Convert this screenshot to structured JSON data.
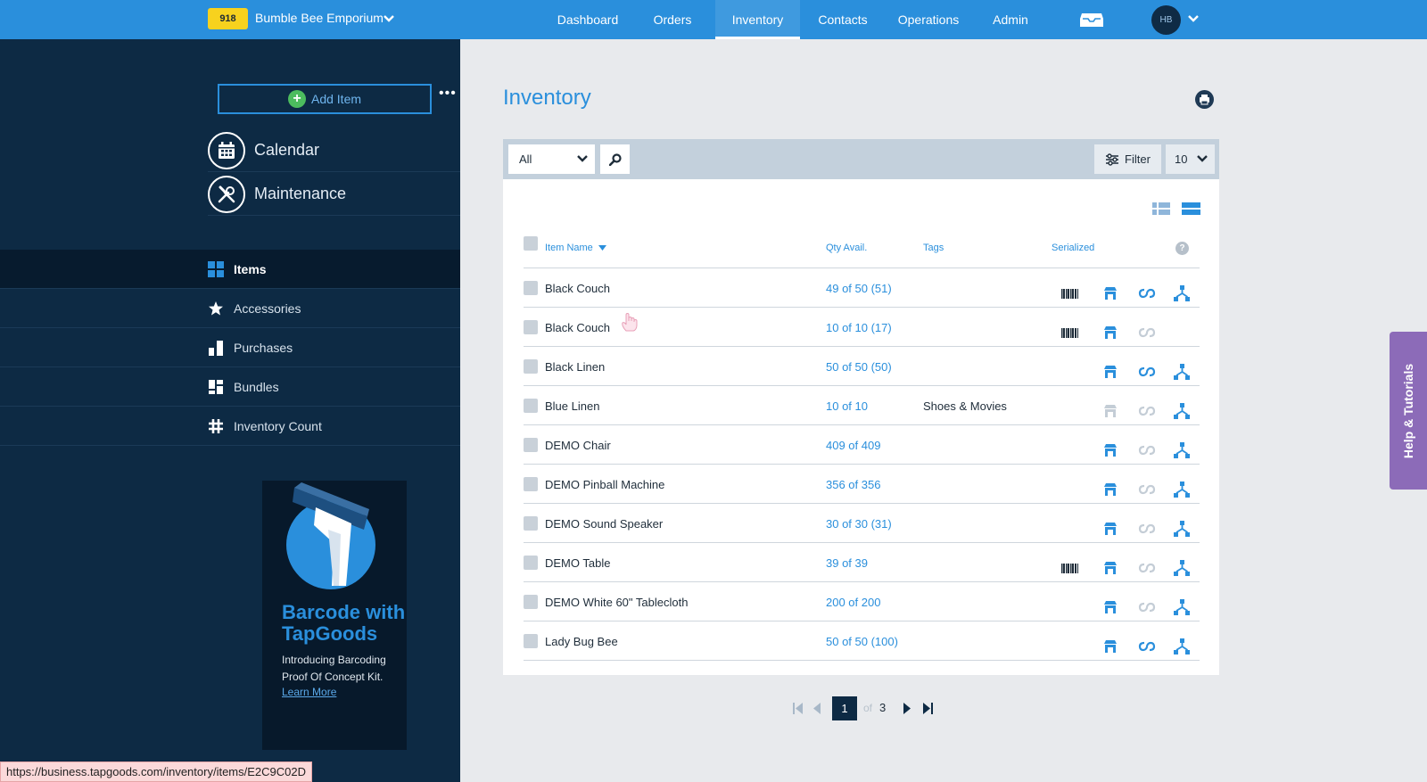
{
  "header": {
    "account_badge": "918",
    "company_name": "Bumble Bee Emporium",
    "nav": [
      {
        "label": "Dashboard"
      },
      {
        "label": "Orders"
      },
      {
        "label": "Inventory",
        "active": true
      },
      {
        "label": "Contacts"
      },
      {
        "label": "Operations"
      },
      {
        "label": "Admin"
      }
    ],
    "user_initials": "HB"
  },
  "sidebar": {
    "add_item_label": "Add Item",
    "more_label": "•••",
    "big_links": [
      {
        "label": "Calendar",
        "icon": "calendar-icon"
      },
      {
        "label": "Maintenance",
        "icon": "tools-icon"
      }
    ],
    "items": [
      {
        "label": "Items",
        "icon": "grid-icon",
        "active": true
      },
      {
        "label": "Accessories",
        "icon": "star-icon"
      },
      {
        "label": "Purchases",
        "icon": "bars-icon"
      },
      {
        "label": "Bundles",
        "icon": "bundle-icon"
      },
      {
        "label": "Inventory Count",
        "icon": "hash-icon"
      }
    ],
    "promo": {
      "title": "Barcode with TapGoods",
      "text": "Introducing Barcoding Proof Of Concept Kit.",
      "link": "Learn More"
    }
  },
  "status_url": "https://business.tapgoods.com/inventory/items/E2C9C02D",
  "main": {
    "title": "Inventory",
    "toolbar": {
      "type_filter": "All",
      "filter_label": "Filter",
      "per_page": "10"
    },
    "table": {
      "columns": {
        "name": "Item Name",
        "qty": "Qty Avail.",
        "tags": "Tags",
        "serialized": "Serialized",
        "help": "?"
      },
      "rows": [
        {
          "name": "Black Couch",
          "qty": "49 of 50 (51)",
          "tags": "",
          "barcode": true,
          "store": true,
          "link": true,
          "tree": true
        },
        {
          "name": "Black Couch",
          "qty": "10 of 10 (17)",
          "tags": "",
          "barcode": true,
          "store": true,
          "link": false,
          "tree": false
        },
        {
          "name": "Black Linen",
          "qty": "50 of 50 (50)",
          "tags": "",
          "barcode": false,
          "store": true,
          "link": true,
          "tree": true
        },
        {
          "name": "Blue Linen",
          "qty": "10 of 10",
          "tags": "Shoes & Movies",
          "barcode": false,
          "store": false,
          "link": false,
          "tree": true
        },
        {
          "name": "DEMO Chair",
          "qty": "409 of 409",
          "tags": "",
          "barcode": false,
          "store": true,
          "link": false,
          "tree": true
        },
        {
          "name": "DEMO Pinball Machine",
          "qty": "356 of 356",
          "tags": "",
          "barcode": false,
          "store": true,
          "link": false,
          "tree": true
        },
        {
          "name": "DEMO Sound Speaker",
          "qty": "30 of 30 (31)",
          "tags": "",
          "barcode": false,
          "store": true,
          "link": false,
          "tree": true
        },
        {
          "name": "DEMO Table",
          "qty": "39 of 39",
          "tags": "",
          "barcode": true,
          "store": true,
          "link": false,
          "tree": true
        },
        {
          "name": "DEMO White 60\" Tablecloth",
          "qty": "200 of 200",
          "tags": "",
          "barcode": false,
          "store": true,
          "link": false,
          "tree": true
        },
        {
          "name": "Lady Bug Bee",
          "qty": "50 of 50 (100)",
          "tags": "",
          "barcode": false,
          "store": true,
          "link": true,
          "tree": true
        }
      ]
    },
    "pagination": {
      "current": "1",
      "of_label": "of",
      "total": "3"
    }
  },
  "help_tab": "Help & Tutorials",
  "colors": {
    "brand_blue": "#2a8fdc",
    "sidebar_navy": "#0d2a44",
    "badge_yellow": "#f7d21e",
    "help_purple": "#8c6bb8",
    "disabled_icon": "#c4cdd6"
  }
}
